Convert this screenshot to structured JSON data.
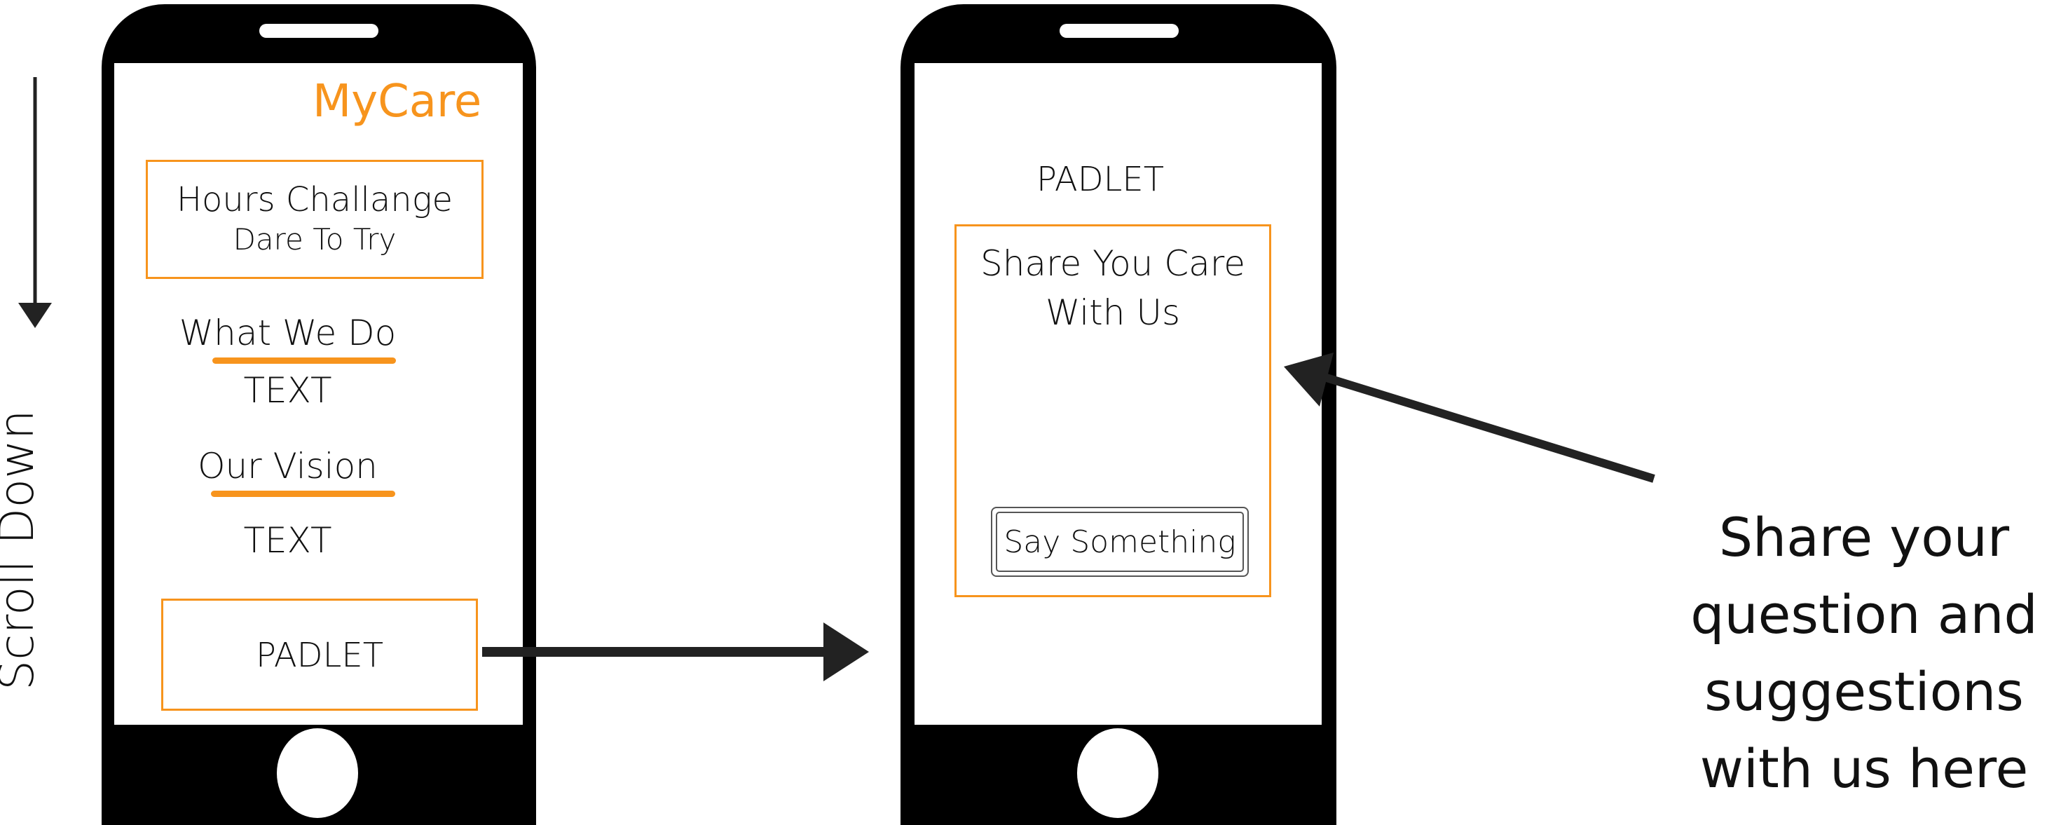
{
  "colors": {
    "accent": "#f7941d",
    "phone": "#000000",
    "arrow": "#222222"
  },
  "left_label": {
    "scroll_text": "Scroll Down"
  },
  "phone_left": {
    "app_title": "MyCare",
    "challenge_card": {
      "title": "Hours Challange",
      "subtitle": "Dare To Try"
    },
    "sections": [
      {
        "heading": "What We Do",
        "body": "TEXT"
      },
      {
        "heading": "Our Vision",
        "body": "TEXT"
      }
    ],
    "padlet_button": "PADLET"
  },
  "phone_right": {
    "header": "PADLET",
    "card": {
      "line1": "Share You Care",
      "line2": "With Us"
    },
    "input_button": "Say Something"
  },
  "caption": {
    "lines": [
      "Share your",
      "question and",
      "suggestions",
      "with us here"
    ]
  },
  "icons": {
    "scroll_arrow": "arrow-down-icon",
    "nav_arrow": "arrow-right-icon",
    "pointer_arrow": "arrow-pointer-icon"
  }
}
